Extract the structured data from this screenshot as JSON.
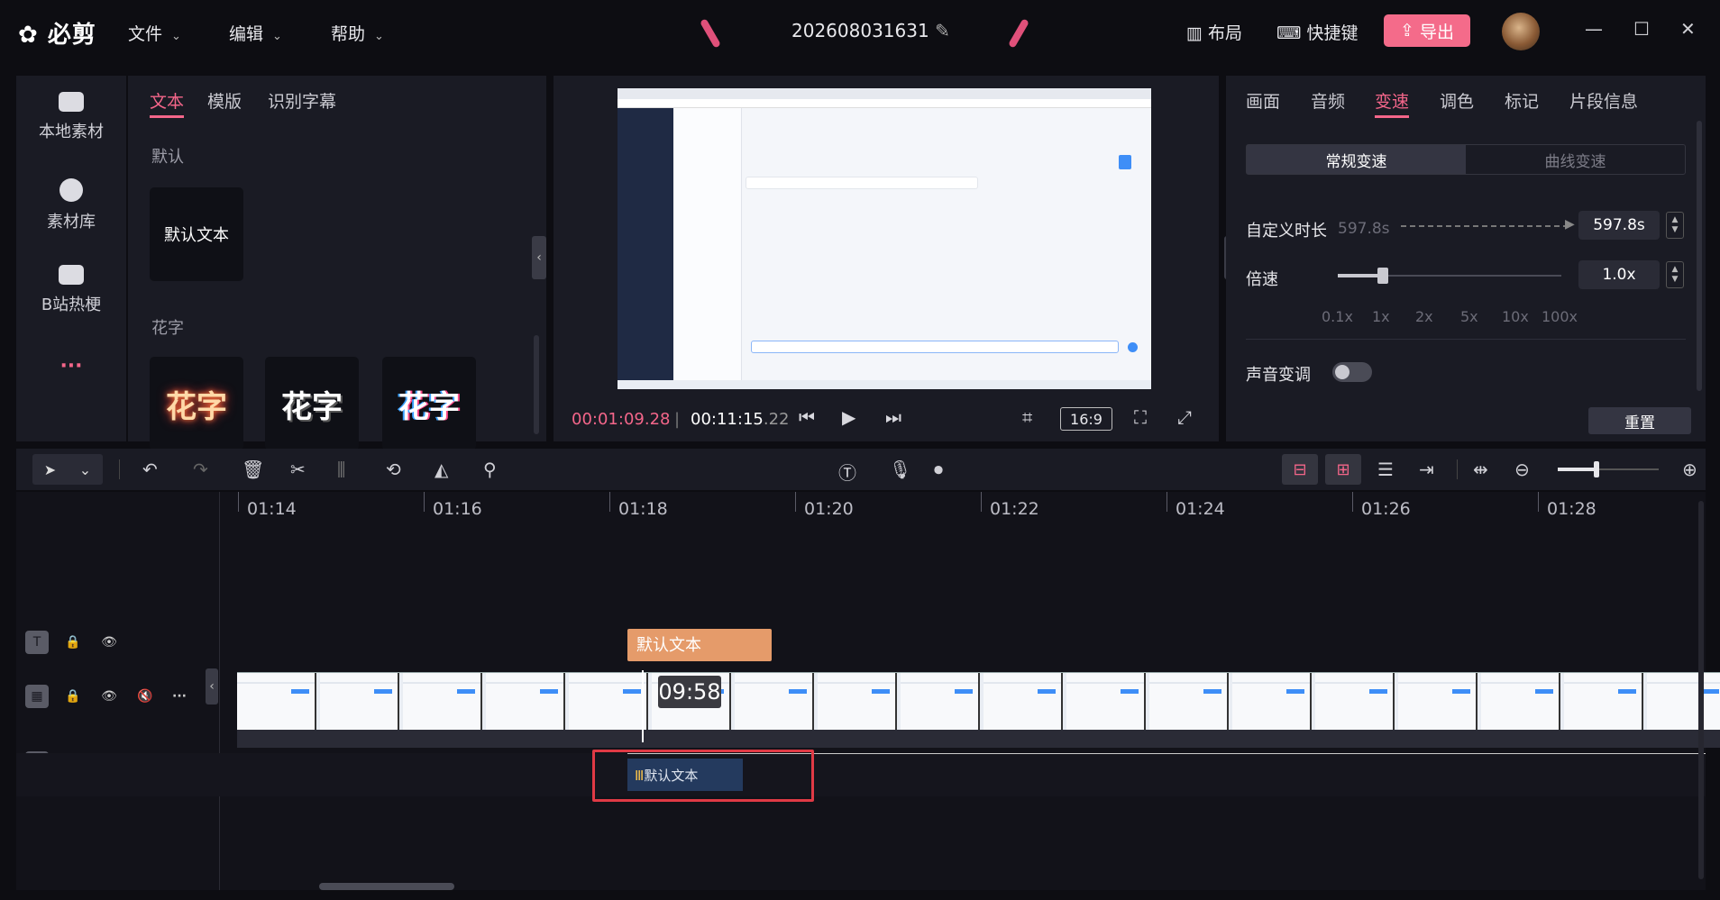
{
  "titlebar": {
    "logo": "必剪",
    "menus": [
      "文件",
      "编辑",
      "帮助"
    ],
    "project_name": "202608031631",
    "layout_label": "布局",
    "shortcuts_label": "快捷键",
    "export_label": "导出"
  },
  "leftnav": {
    "items": [
      {
        "label": "本地素材",
        "icon": "upload-folder-icon"
      },
      {
        "label": "素材库",
        "icon": "panda-icon"
      },
      {
        "label": "B站热梗",
        "icon": "tv-icon"
      }
    ],
    "more_label": "···"
  },
  "textpanel": {
    "tabs": [
      "文本",
      "模版",
      "识别字幕"
    ],
    "section_default": "默认",
    "default_card": "默认文本",
    "section_fancy": "花字",
    "fancy_cards": [
      "花字",
      "花字",
      "花字"
    ]
  },
  "preview": {
    "current_time": "00:01:09",
    "current_frame": ".28",
    "total_time": "00:11:15",
    "total_frame": ".22",
    "separator": "|",
    "ratio": "16:9"
  },
  "rightpanel": {
    "tabs": [
      "画面",
      "音频",
      "变速",
      "调色",
      "标记",
      "片段信息"
    ],
    "segment": [
      "常规变速",
      "曲线变速"
    ],
    "custom_duration_label": "自定义时长",
    "custom_duration_ref": "597.8s",
    "custom_duration_value": "597.8s",
    "speed_label": "倍速",
    "speed_value": "1.0x",
    "speed_ticks": [
      "0.1x",
      "1x",
      "2x",
      "5x",
      "10x",
      "100x"
    ],
    "voice_change_label": "声音变调",
    "reset_label": "重置"
  },
  "timeline": {
    "ruler_labels": [
      "01:14",
      "01:16",
      "01:18",
      "01:20",
      "01:22",
      "01:24",
      "01:26",
      "01:28"
    ],
    "text_clip": "默认文本",
    "audio_clip": "默认文本",
    "playhead_label": "09:58"
  },
  "colors": {
    "accent": "#f4668a",
    "highlight_box": "#e03a45",
    "text_clip": "#e59b6a",
    "audio_clip": "#243a5e"
  }
}
